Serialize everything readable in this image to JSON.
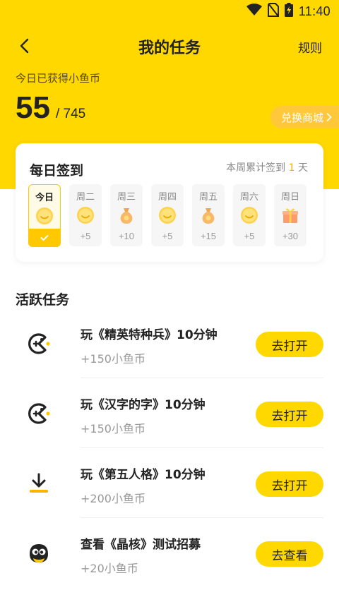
{
  "status": {
    "time": "11:40"
  },
  "header": {
    "title": "我的任务",
    "rules": "规则"
  },
  "coins": {
    "label": "今日已获得小鱼币",
    "today": "55",
    "total": "/ 745"
  },
  "shop": {
    "label": "兑换商城"
  },
  "checkin": {
    "title": "每日签到",
    "stat_prefix": "本周累计签到",
    "stat_count": "1",
    "stat_suffix": "天",
    "days": [
      {
        "label": "今日",
        "reward": "",
        "icon": "smiley-coin-icon",
        "checked": true
      },
      {
        "label": "周二",
        "reward": "+5",
        "icon": "smiley-coin-icon"
      },
      {
        "label": "周三",
        "reward": "+10",
        "icon": "coin-bag-icon"
      },
      {
        "label": "周四",
        "reward": "+5",
        "icon": "smiley-coin-icon"
      },
      {
        "label": "周五",
        "reward": "+15",
        "icon": "coin-bag-icon"
      },
      {
        "label": "周六",
        "reward": "+5",
        "icon": "smiley-coin-icon"
      },
      {
        "label": "周日",
        "reward": "+30",
        "icon": "gift-box-icon"
      }
    ]
  },
  "tasks_section": {
    "title": "活跃任务"
  },
  "tasks": [
    {
      "title": "玩《精英特种兵》10分钟",
      "reward": "+150小鱼币",
      "button": "去打开",
      "icon": "game-pacman-icon"
    },
    {
      "title": "玩《汉字的字》10分钟",
      "reward": "+150小鱼币",
      "button": "去打开",
      "icon": "game-pacman-icon"
    },
    {
      "title": "玩《第五人格》10分钟",
      "reward": "+200小鱼币",
      "button": "去打开",
      "icon": "download-icon"
    },
    {
      "title": "查看《晶核》测试招募",
      "reward": "+20小鱼币",
      "button": "去查看",
      "icon": "mascot-face-icon"
    }
  ],
  "colors": {
    "brand_yellow": "#FFD800",
    "accent_orange": "#FFA800",
    "shop_button": "#FFC83A"
  }
}
